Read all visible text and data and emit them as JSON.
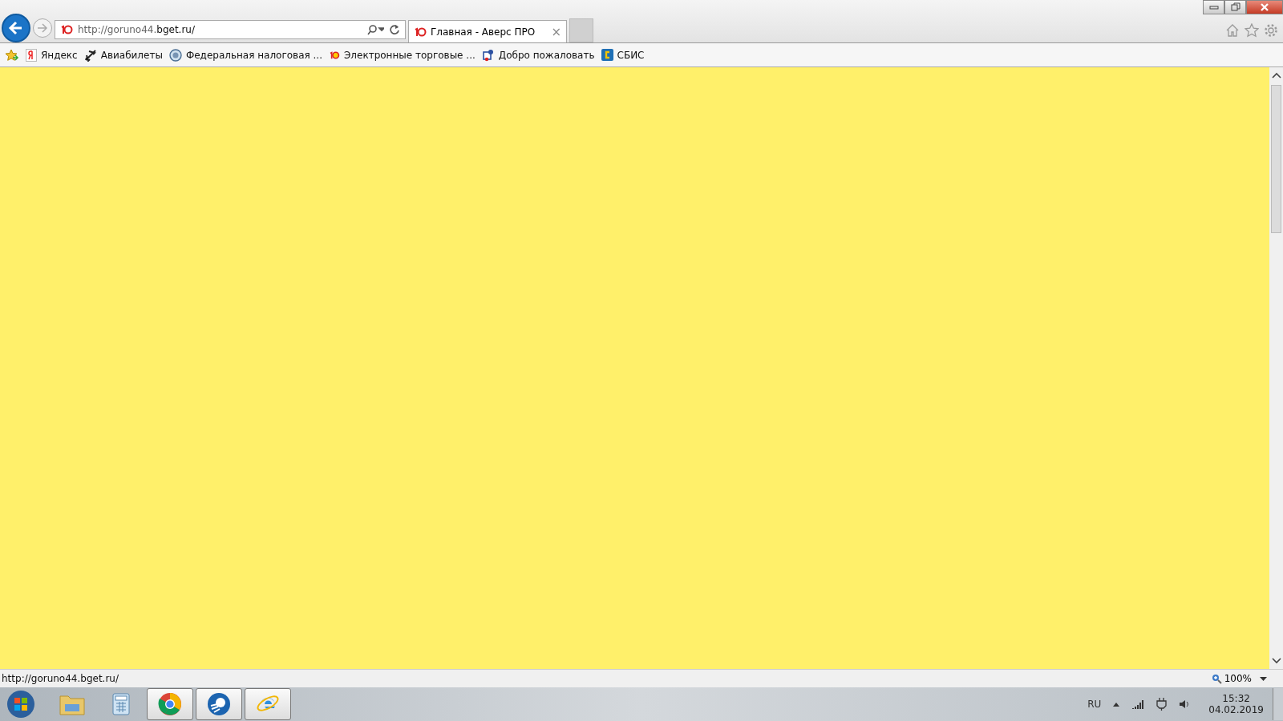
{
  "address_bar": {
    "url_prefix": "http://goruno44.",
    "url_domain": "bget.ru/"
  },
  "tabs": [
    {
      "label": "Главная - Аверс ПРО",
      "close": "×",
      "selected": true
    }
  ],
  "favorites": [
    {
      "label": "Яндекс"
    },
    {
      "label": "Авиабилеты"
    },
    {
      "label": "Федеральная налоговая ..."
    },
    {
      "label": "Электронные торговые ..."
    },
    {
      "label": "Добро пожаловать"
    },
    {
      "label": "СБИС"
    }
  ],
  "status_bar": {
    "text": "http://goruno44.bget.ru/",
    "zoom": "100%"
  },
  "taskbar": {
    "apps": [
      {
        "running": false
      },
      {
        "running": false
      },
      {
        "running": true
      },
      {
        "running": true
      },
      {
        "running": true
      }
    ],
    "language": "RU",
    "time": "15:32",
    "date": "04.02.2019"
  }
}
